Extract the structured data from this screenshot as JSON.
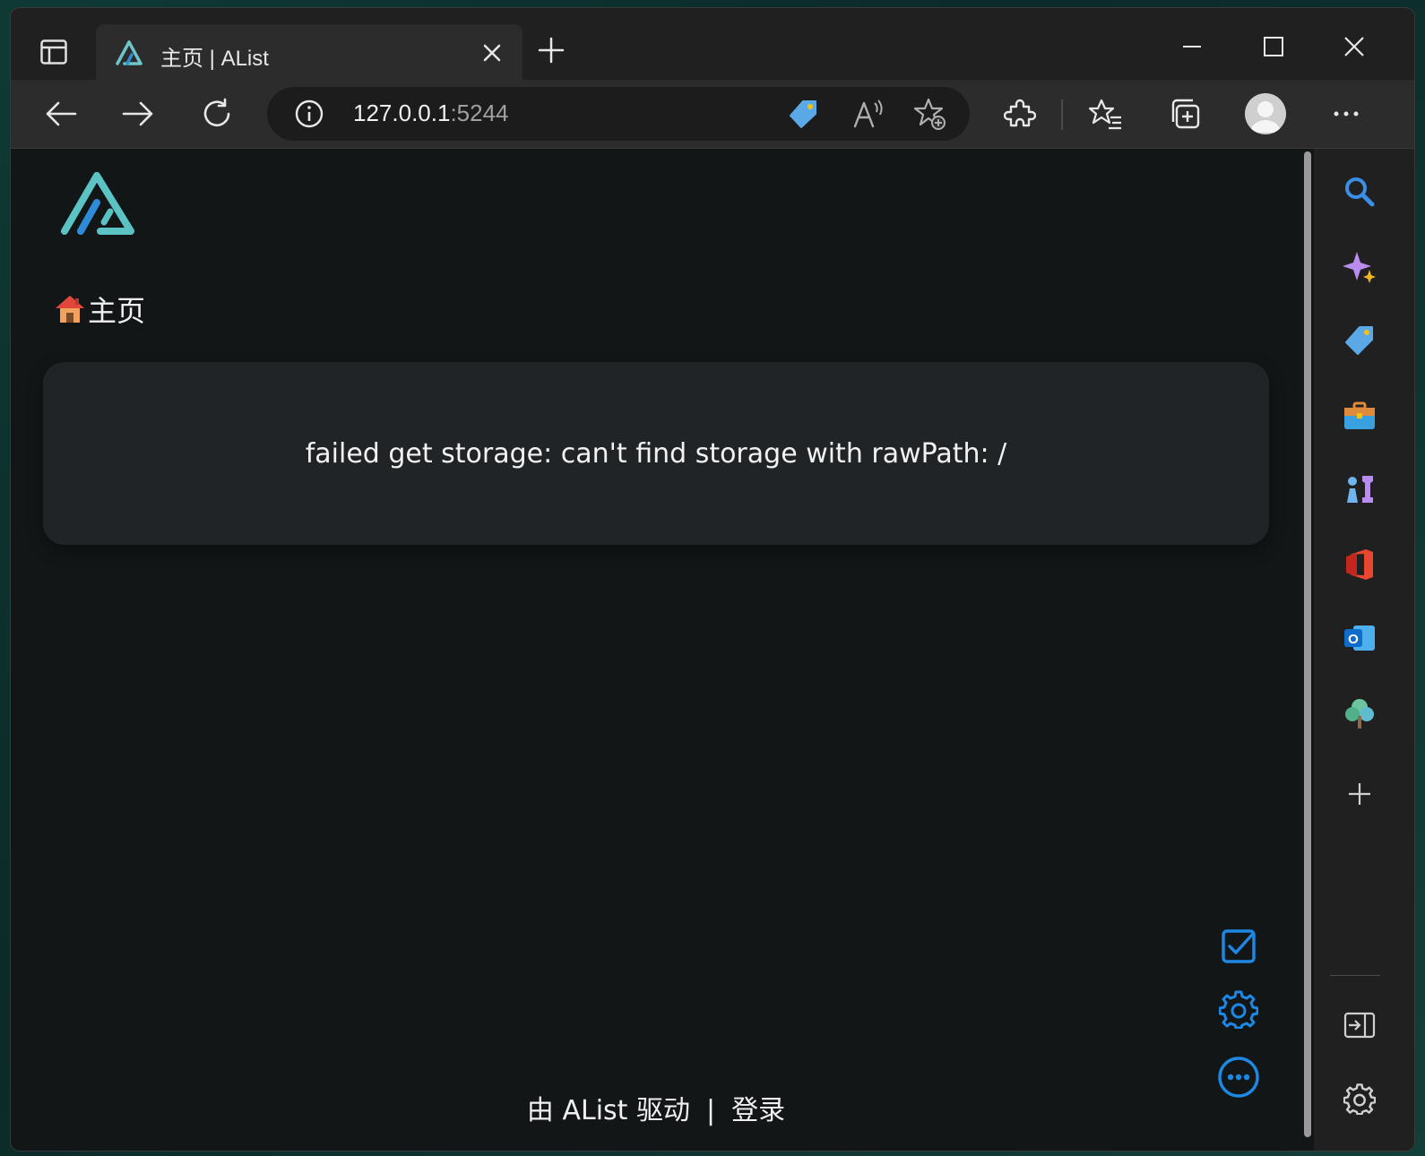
{
  "browser": {
    "tab": {
      "title": "主页 | AList",
      "favicon": "alist-logo-icon"
    },
    "address": {
      "host": "127.0.0.1",
      "port": ":5244"
    },
    "window_controls": [
      "minimize-icon",
      "maximize-icon",
      "close-icon"
    ],
    "toolbar_icons": [
      "back-arrow-icon",
      "forward-arrow-icon",
      "refresh-icon",
      "info-icon",
      "price-tag-icon",
      "read-aloud-icon",
      "add-favorite-icon",
      "extensions-icon",
      "favorites-icon",
      "collections-icon",
      "profile-avatar",
      "more-icon"
    ],
    "sidebar_icons": [
      "search-icon",
      "copilot-sparkle-icon",
      "shopping-tag-icon",
      "tools-briefcase-icon",
      "games-icon",
      "office-icon",
      "outlook-icon",
      "tree-icon",
      "add-icon",
      "hide-sidebar-icon",
      "sidebar-settings-icon"
    ]
  },
  "page": {
    "breadcrumb": {
      "emoji": "🏠",
      "label": "主页"
    },
    "error_message": "failed get storage: can't find storage with rawPath: /",
    "footer": {
      "powered_by": "由 AList 驱动",
      "separator": "|",
      "login": "登录"
    },
    "floating_actions": [
      "select-checkbox-icon",
      "settings-gear-icon",
      "more-options-icon"
    ],
    "accent_color": "#1e88e5",
    "brand_color": "#53c2c7"
  }
}
